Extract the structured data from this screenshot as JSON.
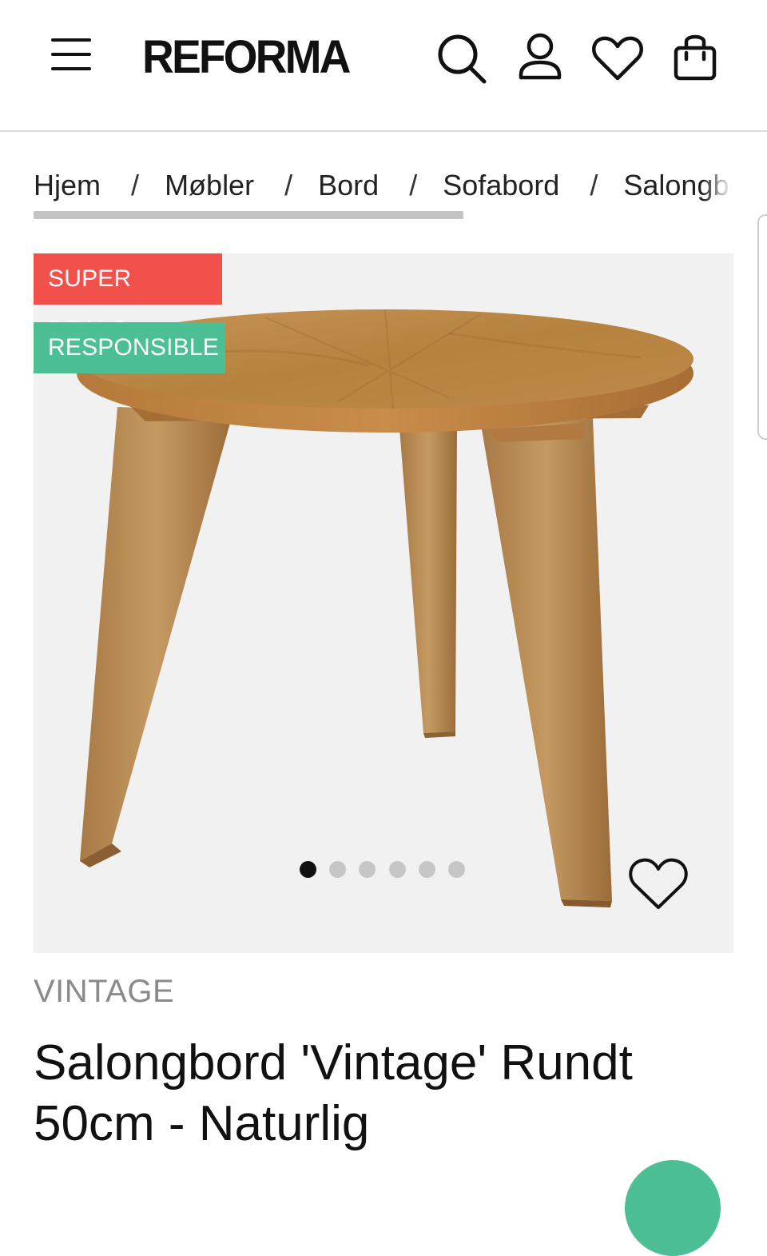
{
  "header": {
    "logo": "REFORMA",
    "icons": [
      "menu-icon",
      "search-icon",
      "account-icon",
      "heart-icon",
      "bag-icon"
    ]
  },
  "breadcrumb": {
    "items": [
      "Hjem",
      "Møbler",
      "Bord",
      "Sofabord",
      "Salongbord"
    ],
    "separator": "/",
    "scroll_fraction": 0.61
  },
  "product": {
    "badges": {
      "deals": "SUPER DEALS",
      "responsible": "RESPONSIBLE"
    },
    "image_count": 6,
    "active_image": 1,
    "brand": "VINTAGE",
    "title": "Salongbord 'Vintage' Rundt 50cm - Naturlig"
  },
  "colors": {
    "deals_badge": "#f2504b",
    "responsible_badge": "#4dbf94",
    "image_background": "#f1f1f1",
    "brand_text": "#8a8a8a",
    "accent": "#4dbf94"
  }
}
